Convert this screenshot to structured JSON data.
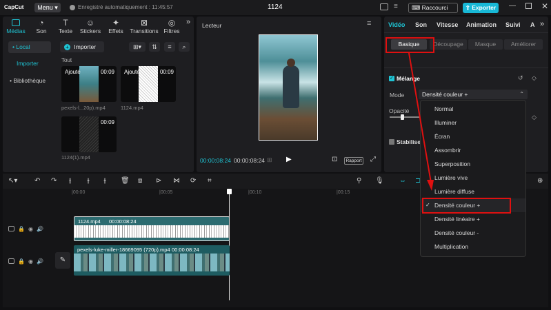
{
  "titlebar": {
    "logo": "CapCut",
    "menu_label": "Menu",
    "autosave": "Enregistré automatiquement : 11:45:57",
    "project_name": "1124",
    "shortcuts_label": "Raccourci",
    "export_label": "Exporter"
  },
  "media_tabs": [
    {
      "label": "Médias",
      "icon": "media-icon"
    },
    {
      "label": "Son",
      "icon": "audio-icon"
    },
    {
      "label": "Texte",
      "icon": "text-icon"
    },
    {
      "label": "Stickers",
      "icon": "sticker-icon"
    },
    {
      "label": "Effets",
      "icon": "effects-icon"
    },
    {
      "label": "Transitions",
      "icon": "transition-icon"
    },
    {
      "label": "Filtres",
      "icon": "filter-icon"
    }
  ],
  "media_sidebar": {
    "local": "• Local",
    "import": "Importer",
    "library": "• Bibliothèque"
  },
  "media_panel": {
    "import_button": "Importer",
    "section_all": "Tout",
    "clips": [
      {
        "badge": "Ajouté",
        "duration": "00:09",
        "name": "pexels-l...20p).mp4"
      },
      {
        "badge": "Ajouté",
        "duration": "00:09",
        "name": "1124.mp4"
      },
      {
        "badge": "",
        "duration": "00:09",
        "name": "1124(1).mp4"
      }
    ]
  },
  "player": {
    "title": "Lecteur",
    "current_time": "00:00:08:24",
    "total_time": "00:00:08:24",
    "ratio_label": "Rapport"
  },
  "inspector": {
    "tabs": [
      "Vidéo",
      "Son",
      "Vitesse",
      "Animation",
      "Suivi",
      "A"
    ],
    "subtabs": [
      "Basique",
      "Découpage",
      "Masque",
      "Améliorer"
    ],
    "blend_section": "Mélange",
    "mode_label": "Mode",
    "mode_value": "Densité couleur +",
    "opacity_label": "Opacité",
    "stabilize_label": "Stabilise",
    "blend_options": [
      "Normal",
      "Illuminer",
      "Écran",
      "Assombrir",
      "Superposition",
      "Lumière vive",
      "Lumière diffuse",
      "Densité couleur +",
      "Densité linéaire +",
      "Densité couleur -",
      "Multiplication"
    ],
    "selected_option": "Densité couleur +"
  },
  "timeline": {
    "ruler": [
      "|00:00",
      "|00:05",
      "|00:10",
      "|00:15"
    ],
    "clip_top": {
      "name": "1124.mp4",
      "duration": "00:00:08:24"
    },
    "clip_main": {
      "name": "pexels-luke-miller-18669095 (720p).mp4",
      "duration": "00:00:08:24"
    }
  },
  "colors": {
    "accent": "#1fc4d4",
    "annotation": "#e01010",
    "export_bg": "#18b8d6"
  }
}
